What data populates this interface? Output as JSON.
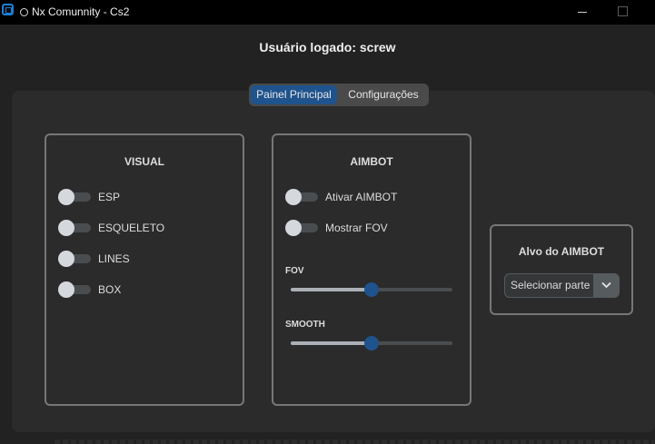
{
  "window": {
    "title": "Nx Comunnity  - Cs2"
  },
  "header": {
    "user_text": "Usuário logado: screw"
  },
  "tabs": [
    {
      "label": "Painel Principal",
      "selected": true
    },
    {
      "label": "Configurações",
      "selected": false
    }
  ],
  "visual": {
    "title": "VISUAL",
    "toggles": [
      {
        "label": "ESP",
        "on": false
      },
      {
        "label": "ESQUELETO",
        "on": false
      },
      {
        "label": "LINES",
        "on": false
      },
      {
        "label": "BOX",
        "on": false
      }
    ]
  },
  "aimbot": {
    "title": "AIMBOT",
    "toggles": [
      {
        "label": "Ativar AIMBOT",
        "on": false
      },
      {
        "label": "Mostrar FOV",
        "on": false
      }
    ],
    "sliders": [
      {
        "label": "FOV",
        "value": 0.5
      },
      {
        "label": "SMOOTH",
        "value": 0.5
      }
    ]
  },
  "target": {
    "title": "Alvo do AIMBOT",
    "select_value": "Selecionar parte"
  },
  "colors": {
    "accent": "#1f538d",
    "panel": "#2b2b2b",
    "background": "#222222",
    "border": "#777777"
  }
}
